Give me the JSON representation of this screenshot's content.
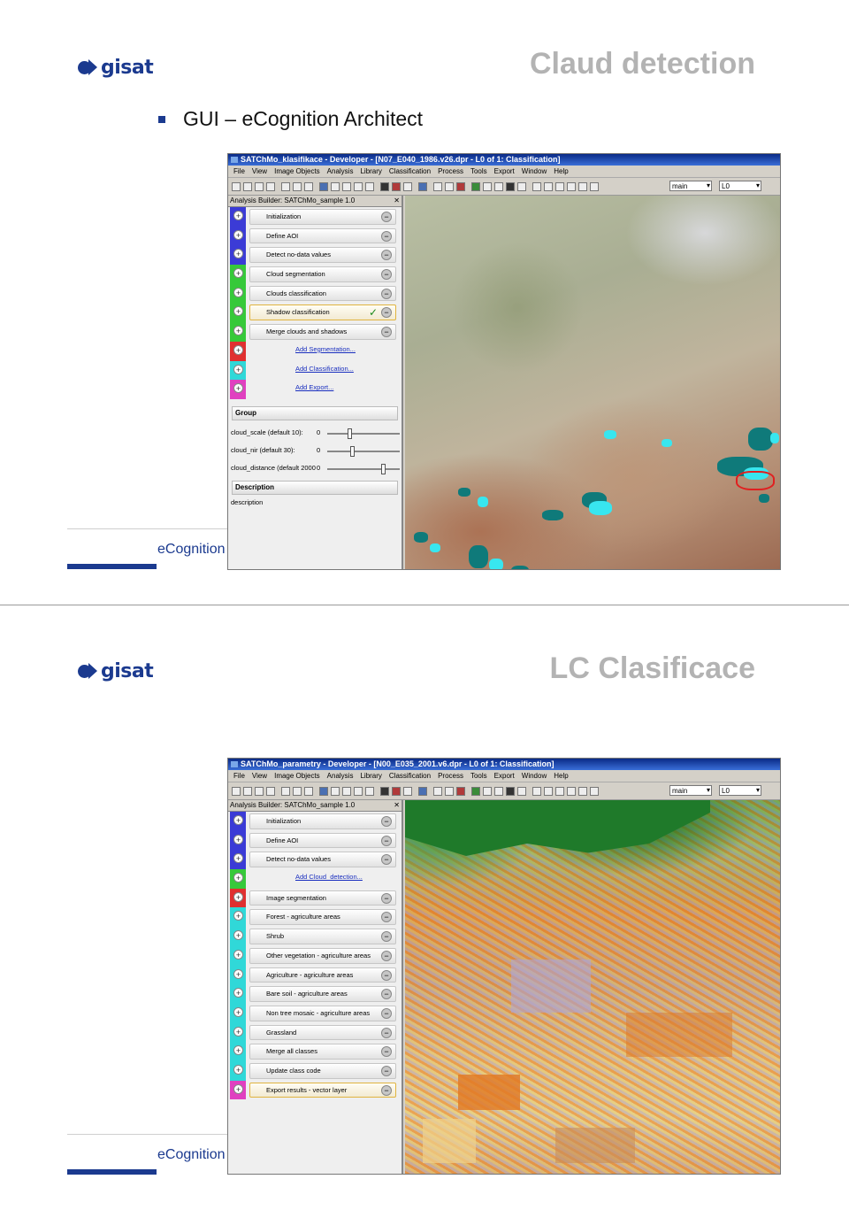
{
  "colors": {
    "brand": "#1b3a8f",
    "title_gray": "#b3b3b3",
    "window_title": "#0a2a86",
    "checkmark": "#1c8a1c",
    "cloud": "#38e6ef",
    "shadow": "#0f7a7a",
    "selection": "#e02020"
  },
  "logo": {
    "text": "gisat"
  },
  "slide1": {
    "title": "Claud detection",
    "bullet": "GUI – eCognition Architect",
    "footer": "eCognition",
    "app": {
      "window_title": "SATChMo_klasifikace - Developer - [N07_E040_1986.v26.dpr - L0 of 1: Classification]",
      "menu": [
        "File",
        "View",
        "Image Objects",
        "Analysis",
        "Library",
        "Classification",
        "Process",
        "Tools",
        "Export",
        "Window",
        "Help"
      ],
      "map_select": "main",
      "level_select": "L0",
      "builder_title": "Analysis Builder: SATChMo_sample 1.0",
      "steps": [
        {
          "label": "Initialization",
          "stripe": "#3b3bd6"
        },
        {
          "label": "Define AOI",
          "stripe": "#3b3bd6"
        },
        {
          "label": "Detect no-data values",
          "stripe": "#3b3bd6"
        },
        {
          "label": "Cloud segmentation",
          "stripe": "#36c93a"
        },
        {
          "label": "Clouds classification",
          "stripe": "#36c93a"
        },
        {
          "label": "Shadow classification",
          "stripe": "#36c93a",
          "selected": true
        },
        {
          "label": "Merge clouds and shadows",
          "stripe": "#36c93a"
        },
        {
          "link": "Add Segmentation...",
          "stripe": "#e03030"
        },
        {
          "link": "Add Classification...",
          "stripe": "#30d8d8"
        },
        {
          "link": "Add Export...",
          "stripe": "#e040c0"
        }
      ],
      "group_label": "Group",
      "params": [
        {
          "label": "cloud_scale (default 10):",
          "value": "0",
          "level": 0.28
        },
        {
          "label": "cloud_nir (default 30):",
          "value": "0",
          "level": 0.32
        },
        {
          "label": "cloud_distance (default 2000",
          "value": "0",
          "level": 0.74
        }
      ],
      "description_label": "Description",
      "description_text": "description"
    }
  },
  "slide2": {
    "title": "LC Clasificace",
    "footer": "eCognition",
    "app": {
      "window_title": "SATChMo_parametry - Developer - [N00_E035_2001.v6.dpr - L0 of 1: Classification]",
      "menu": [
        "File",
        "View",
        "Image Objects",
        "Analysis",
        "Library",
        "Classification",
        "Process",
        "Tools",
        "Export",
        "Window",
        "Help"
      ],
      "map_select": "main",
      "level_select": "L0",
      "builder_title": "Analysis Builder: SATChMo_sample 1.0",
      "steps": [
        {
          "label": "Initialization",
          "stripe": "#3b3bd6"
        },
        {
          "label": "Define AOI",
          "stripe": "#3b3bd6"
        },
        {
          "label": "Detect no-data values",
          "stripe": "#3b3bd6"
        },
        {
          "link": "Add Cloud_detection...",
          "stripe": "#36c93a"
        },
        {
          "label": "Image segmentation",
          "stripe": "#e03030"
        },
        {
          "label": "Forest - agriculture areas",
          "stripe": "#30d8d8"
        },
        {
          "label": "Shrub",
          "stripe": "#30d8d8"
        },
        {
          "label": "Other vegetation - agriculture areas",
          "stripe": "#30d8d8"
        },
        {
          "label": "Agriculture - agriculture areas",
          "stripe": "#30d8d8"
        },
        {
          "label": "Bare soil - agriculture areas",
          "stripe": "#30d8d8"
        },
        {
          "label": "Non tree mosaic - agriculture areas",
          "stripe": "#30d8d8"
        },
        {
          "label": "Grassland",
          "stripe": "#30d8d8"
        },
        {
          "label": "Merge all classes",
          "stripe": "#30d8d8"
        },
        {
          "label": "Update class code",
          "stripe": "#30d8d8"
        },
        {
          "label": "Export results - vector layer",
          "stripe": "#e040c0",
          "selected": true
        }
      ]
    }
  }
}
